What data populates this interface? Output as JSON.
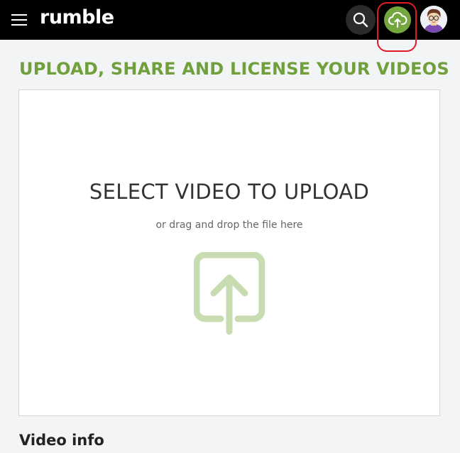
{
  "header": {
    "logo_text": "rumble",
    "menu_icon": "hamburger-menu-icon",
    "search_icon": "search-icon",
    "upload_icon": "cloud-upload-icon",
    "highlight_color": "#e01b24",
    "upload_button_color": "#74a73f",
    "background_color": "#000000"
  },
  "main": {
    "title": "UPLOAD, SHARE AND LICENSE YOUR VIDEOS",
    "title_color": "#6fa03b",
    "dropzone": {
      "heading": "SELECT VIDEO TO UPLOAD",
      "subtext": "or drag and drop the file here",
      "icon": "upload-arrow-box-icon",
      "icon_color": "#c7dcb0"
    },
    "video_info_label": "Video info"
  }
}
